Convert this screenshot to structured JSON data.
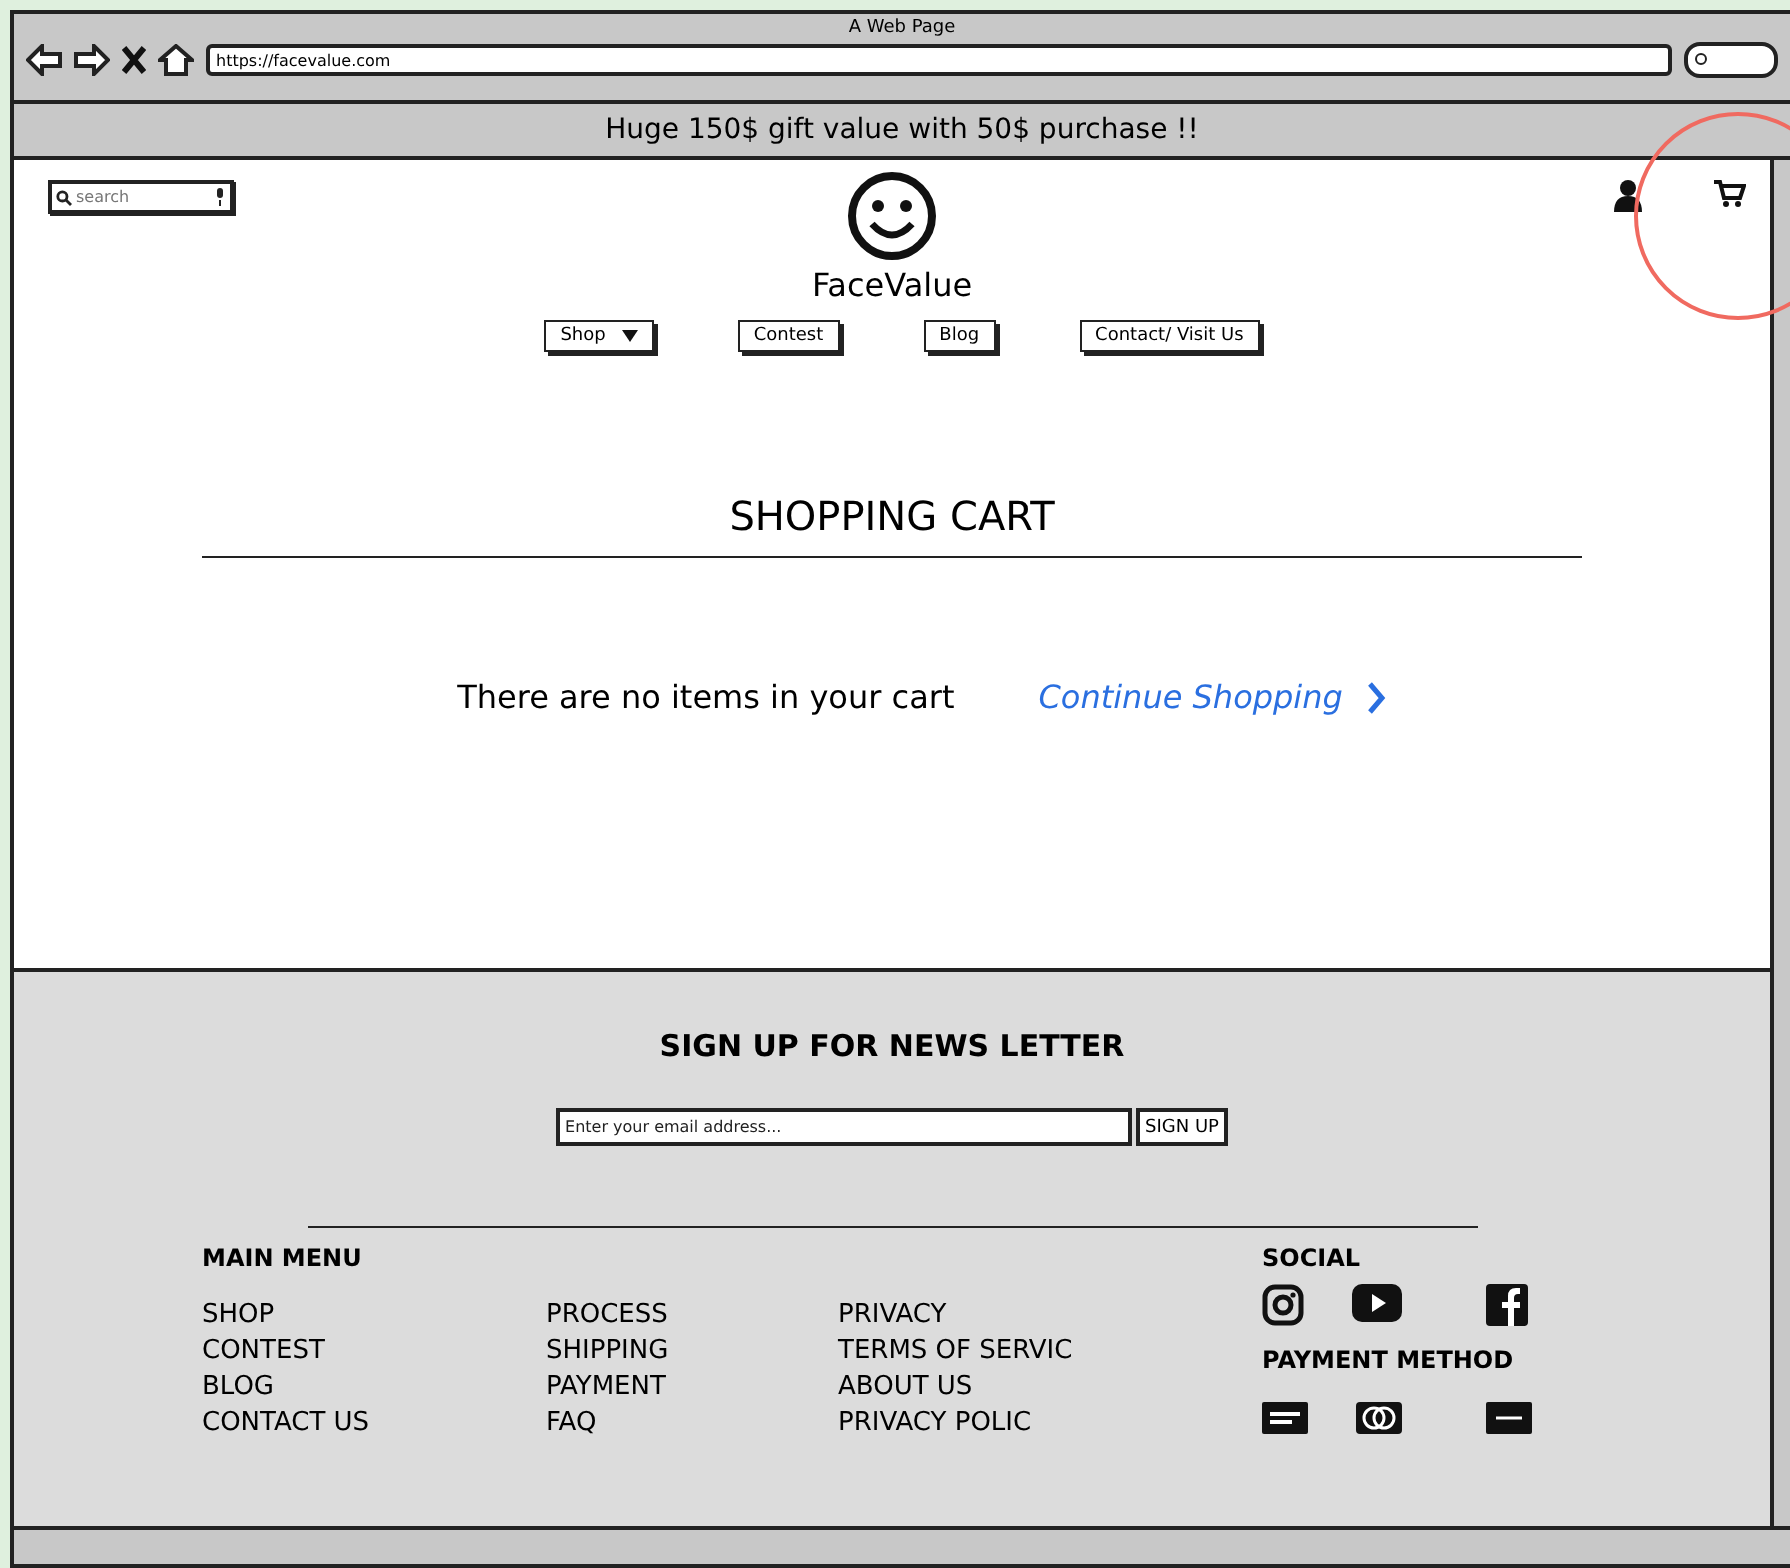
{
  "window": {
    "title": "A Web Page",
    "url": "https://facevalue.com"
  },
  "banner": "Huge 150$ gift value with 50$ purchase !!",
  "search": {
    "placeholder": "search"
  },
  "brand": "FaceValue",
  "nav": [
    {
      "label": "Shop",
      "has_dropdown": true
    },
    {
      "label": "Contest",
      "has_dropdown": false
    },
    {
      "label": "Blog",
      "has_dropdown": false
    },
    {
      "label": "Contact/ Visit Us",
      "has_dropdown": false
    }
  ],
  "cart": {
    "title": "SHOPPING CART",
    "message": "There are no items in your cart",
    "link": "Continue Shopping"
  },
  "newsletter": {
    "title": "SIGN UP FOR NEWS LETTER",
    "placeholder": "Enter your email address...",
    "button": "SIGN UP"
  },
  "footer": {
    "menu_title": "MAIN MENU",
    "columns": [
      [
        "SHOP",
        "CONTEST",
        "BLOG",
        "CONTACT US"
      ],
      [
        "PROCESS",
        "SHIPPING",
        "PAYMENT",
        "FAQ"
      ],
      [
        "PRIVACY",
        "TERMS OF SERVIC",
        "ABOUT US",
        "PRIVACY POLIC"
      ]
    ],
    "social_title": "SOCIAL",
    "payment_title": "PAYMENT METHOD"
  }
}
